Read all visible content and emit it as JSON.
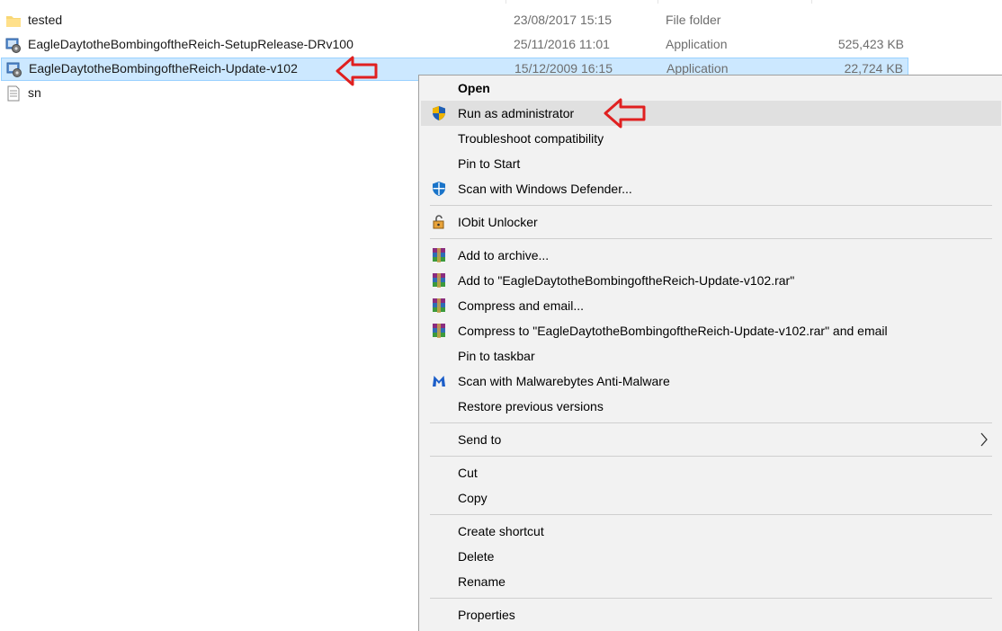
{
  "files": [
    {
      "name": "tested",
      "date": "23/08/2017 15:15",
      "type": "File folder",
      "size": "",
      "icon": "folder-icon",
      "selected": false
    },
    {
      "name": "EagleDaytotheBombingoftheReich-SetupRelease-DRv100",
      "date": "25/11/2016 11:01",
      "type": "Application",
      "size": "525,423 KB",
      "icon": "setup-app-icon",
      "selected": false
    },
    {
      "name": "EagleDaytotheBombingoftheReich-Update-v102",
      "date": "15/12/2009 16:15",
      "type": "Application",
      "size": "22,724 KB",
      "icon": "setup-app-icon",
      "selected": true
    },
    {
      "name": "sn",
      "date": "",
      "type": "",
      "size": "",
      "icon": "text-file-icon",
      "selected": false
    }
  ],
  "context_menu": {
    "items": [
      {
        "label": "Open",
        "icon": "",
        "bold": true
      },
      {
        "label": "Run as administrator",
        "icon": "uac-shield-icon",
        "hovered": true
      },
      {
        "label": "Troubleshoot compatibility",
        "icon": ""
      },
      {
        "label": "Pin to Start",
        "icon": ""
      },
      {
        "label": "Scan with Windows Defender...",
        "icon": "windows-defender-icon"
      },
      {
        "label": "IObit Unlocker",
        "icon": "iobit-unlocker-icon"
      },
      {
        "label": "Add to archive...",
        "icon": "winrar-icon"
      },
      {
        "label": "Add to \"EagleDaytotheBombingoftheReich-Update-v102.rar\"",
        "icon": "winrar-icon"
      },
      {
        "label": "Compress and email...",
        "icon": "winrar-icon"
      },
      {
        "label": "Compress to \"EagleDaytotheBombingoftheReich-Update-v102.rar\" and email",
        "icon": "winrar-icon"
      },
      {
        "label": "Pin to taskbar",
        "icon": ""
      },
      {
        "label": "Scan with Malwarebytes Anti-Malware",
        "icon": "malwarebytes-icon"
      },
      {
        "label": "Restore previous versions",
        "icon": ""
      },
      {
        "label": "Send to",
        "icon": "",
        "submenu": true
      },
      {
        "label": "Cut",
        "icon": ""
      },
      {
        "label": "Copy",
        "icon": ""
      },
      {
        "label": "Create shortcut",
        "icon": ""
      },
      {
        "label": "Delete",
        "icon": ""
      },
      {
        "label": "Rename",
        "icon": ""
      },
      {
        "label": "Properties",
        "icon": ""
      }
    ]
  },
  "colors": {
    "selection_bg": "#cce8ff",
    "menu_bg": "#f2f2f2",
    "hover_bg": "#e0e0e0",
    "annotation_arrow": "#e02020"
  }
}
